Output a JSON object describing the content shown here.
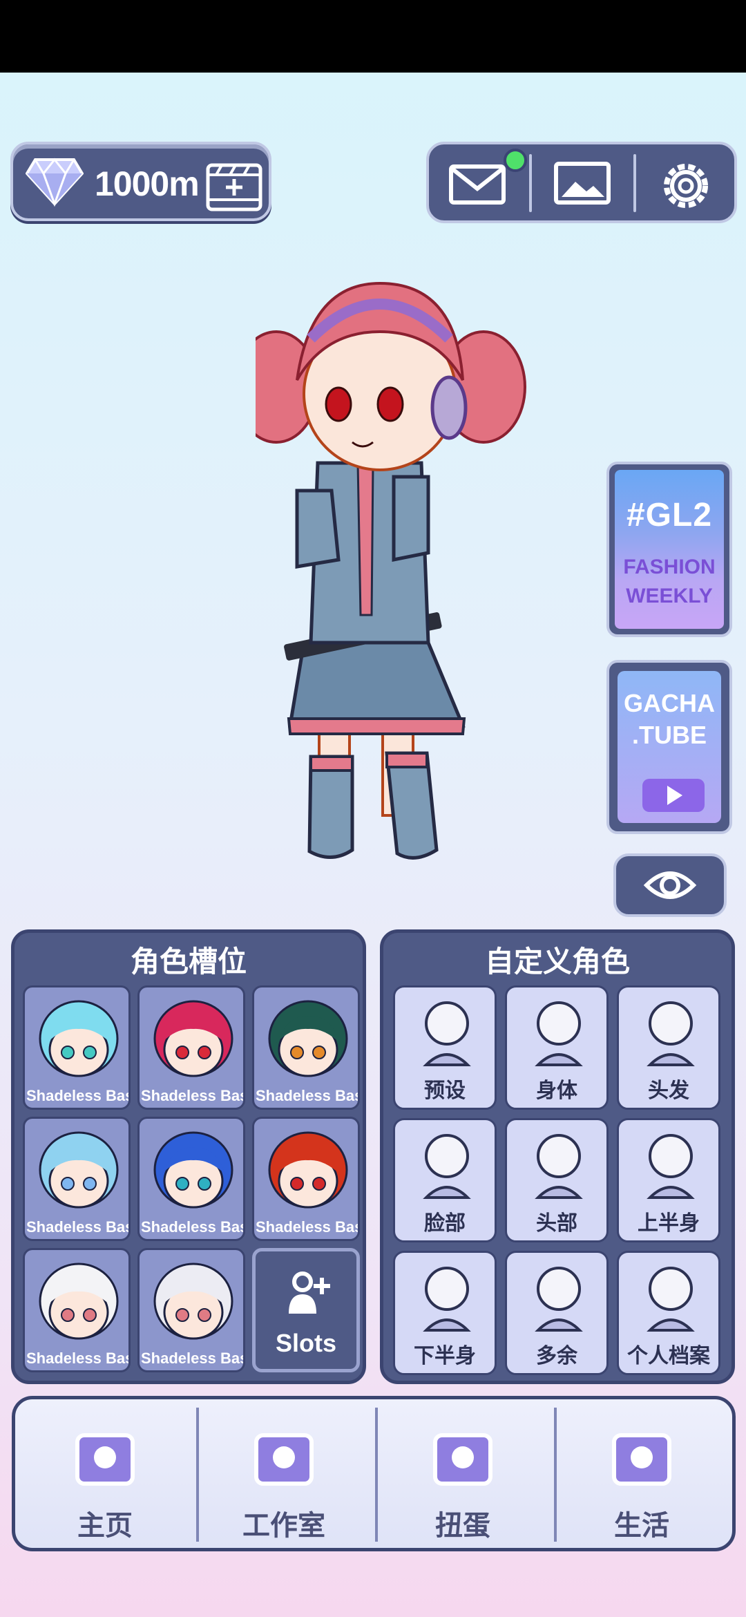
{
  "currency": {
    "amount": "1000m",
    "icon": "diamond-icon",
    "add_icon": "add-video-icon"
  },
  "topbar": {
    "icons": [
      "mail-icon",
      "gallery-icon",
      "settings-icon"
    ],
    "mail_has_notification": true
  },
  "side": {
    "gl2": {
      "hashtag": "#GL2",
      "line1": "FASHION",
      "line2": "WEEKLY"
    },
    "gacha": {
      "line1": "GACHA",
      "line2": ".TUBE",
      "icon": "play-icon"
    },
    "eye_icon": "eye-icon"
  },
  "slots_panel": {
    "title": "角色槽位",
    "slots": [
      {
        "name": "Shadeless Base",
        "hair": "#7fdcef",
        "eyes": "#45c9c2"
      },
      {
        "name": "Shadeless Base",
        "hair": "#d8285c",
        "eyes": "#d92a3a"
      },
      {
        "name": "Shadeless Base",
        "hair": "#1f5a4f",
        "eyes": "#e58a2a"
      },
      {
        "name": "Shadeless Base",
        "hair": "#8fd2f0",
        "eyes": "#7fb6f0"
      },
      {
        "name": "Shadeless Base",
        "hair": "#2e5fd8",
        "eyes": "#2fb0c2"
      },
      {
        "name": "Shadeless Base",
        "hair": "#d4341c",
        "eyes": "#d42a2a"
      },
      {
        "name": "Shadeless Base",
        "hair": "#f3f3f6",
        "eyes": "#e07b84"
      },
      {
        "name": "Shadeless Base",
        "hair": "#ececf3",
        "eyes": "#e07b84"
      }
    ],
    "add_label": "Slots",
    "add_icon": "add-person-icon"
  },
  "custom_panel": {
    "title": "自定义角色",
    "items": [
      {
        "label": "预设",
        "icon": "preset-icon"
      },
      {
        "label": "身体",
        "icon": "body-icon"
      },
      {
        "label": "头发",
        "icon": "hair-icon"
      },
      {
        "label": "脸部",
        "icon": "face-icon"
      },
      {
        "label": "头部",
        "icon": "head-accessory-icon"
      },
      {
        "label": "上半身",
        "icon": "upper-body-icon"
      },
      {
        "label": "下半身",
        "icon": "lower-body-icon"
      },
      {
        "label": "多余",
        "icon": "extra-icon"
      },
      {
        "label": "个人档案",
        "icon": "profile-icon"
      }
    ]
  },
  "bottom_nav": [
    {
      "label": "主页",
      "icon": "home-icon"
    },
    {
      "label": "工作室",
      "icon": "studio-icon"
    },
    {
      "label": "扭蛋",
      "icon": "gacha-icon"
    },
    {
      "label": "生活",
      "icon": "life-icon"
    }
  ]
}
